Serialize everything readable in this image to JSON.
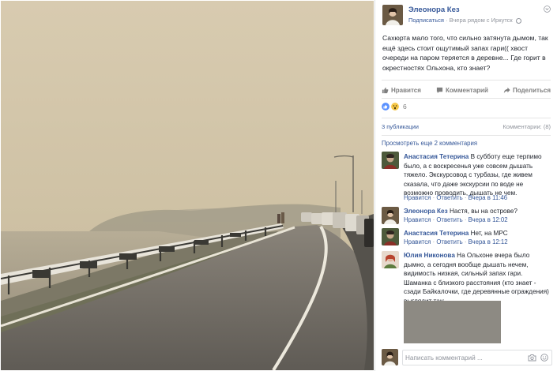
{
  "post": {
    "author": "Элеонора Кез",
    "subscribe": "Подписаться",
    "sep": " · ",
    "time_place": "Вчера рядом с Иркутск",
    "text": "Сахюрта мало того, что сильно затянута дымом, так ещё здесь стоит ощутимый запах гари(( хвост очереди на паром теряется в деревне... Где горит в окрестностях Ольхона, кто знает?"
  },
  "actions": {
    "like": "Нравится",
    "comment": "Комментарий",
    "share": "Поделиться"
  },
  "reactions": {
    "count": "6"
  },
  "stats": {
    "shares": "3 публикации",
    "comments": "Комментарии: (8)"
  },
  "more_comments": "Просмотреть еще 2 комментария",
  "comments": [
    {
      "name": "Анастасия Тетерина",
      "text": "В субботу еще терпимо было, а с воскресенья уже совсем дышать тяжело. Экскурсовод с турбазы, где живем сказала, что даже экскурсии по воде не возможно проводить, дышать не чем.",
      "like": "Нравится",
      "reply": "Ответить",
      "time": "Вчера в 11:46"
    },
    {
      "name": "Элеонора Кез",
      "text": "Настя, вы на острове?",
      "like": "Нравится",
      "reply": "Ответить",
      "time": "Вчера в 12:02"
    },
    {
      "name": "Анастасия Тетерина",
      "text": "Нет, на МРС",
      "like": "Нравится",
      "reply": "Ответить",
      "time": "Вчера в 12:12"
    },
    {
      "name": "Юлия Никонова",
      "text": "На Ольхоне вчера было дымно, а сегодня вообще дышать нечем, видимость низкая, сильный запах гари. Шаманка с близкого расстояния (кто знает - сзади Байкалочки, где деревянные ограждения) выглядит так:"
    }
  ],
  "input": {
    "placeholder": "Написать комментарий ..."
  },
  "colors": {
    "link": "#365899",
    "meta": "#90949c",
    "haze": "#d3c6a8",
    "road": "#6e6a63"
  }
}
